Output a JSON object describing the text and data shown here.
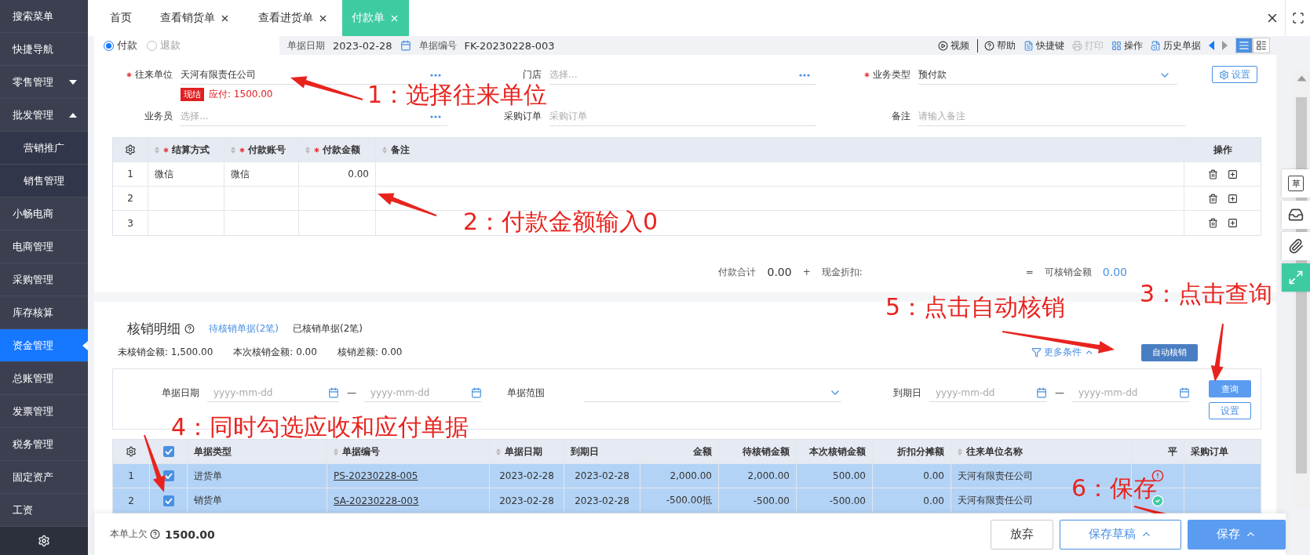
{
  "sidebar": {
    "items": [
      {
        "label": "搜索菜单",
        "kind": "item",
        "selected": false
      },
      {
        "label": "快捷导航",
        "kind": "item",
        "selected": false
      },
      {
        "label": "零售管理",
        "kind": "group",
        "expanded": false,
        "selected": false
      },
      {
        "label": "批发管理",
        "kind": "group",
        "expanded": true,
        "selected": false
      },
      {
        "label": "营销推广",
        "kind": "sub",
        "selected": false
      },
      {
        "label": "销售管理",
        "kind": "sub",
        "selected": false
      },
      {
        "label": "小畅电商",
        "kind": "item",
        "selected": false
      },
      {
        "label": "电商管理",
        "kind": "item",
        "selected": false
      },
      {
        "label": "采购管理",
        "kind": "item",
        "selected": false
      },
      {
        "label": "库存核算",
        "kind": "item",
        "selected": false
      },
      {
        "label": "资金管理",
        "kind": "item",
        "selected": true
      },
      {
        "label": "总账管理",
        "kind": "item",
        "selected": false
      },
      {
        "label": "发票管理",
        "kind": "item",
        "selected": false
      },
      {
        "label": "税务管理",
        "kind": "item",
        "selected": false
      },
      {
        "label": "固定资产",
        "kind": "item",
        "selected": false
      },
      {
        "label": "工资",
        "kind": "item",
        "selected": false
      }
    ]
  },
  "tabs": [
    {
      "label": "首页",
      "closable": false,
      "selected": false
    },
    {
      "label": "查看销货单",
      "closable": true,
      "selected": false
    },
    {
      "label": "查看进货单",
      "closable": true,
      "selected": false
    },
    {
      "label": "付款单",
      "closable": true,
      "selected": true
    }
  ],
  "toolbar": {
    "modes": [
      {
        "label": "付款",
        "selected": true
      },
      {
        "label": "退款",
        "selected": false
      }
    ],
    "date_label": "单据日期",
    "date": "2023-02-28",
    "number_label": "单据编号",
    "number": "FK-20230228-003",
    "actions": [
      {
        "kind": "video",
        "label": "视频",
        "disabled": false
      },
      {
        "kind": "help",
        "label": "帮助",
        "disabled": false
      },
      {
        "kind": "keys",
        "label": "快捷键",
        "disabled": false
      },
      {
        "kind": "print",
        "label": "打印",
        "disabled": true
      },
      {
        "kind": "ops",
        "label": "操作",
        "disabled": false
      },
      {
        "kind": "history",
        "label": "历史单据",
        "disabled": false
      }
    ],
    "views": [
      {
        "kind": "list",
        "selected": true
      },
      {
        "kind": "detail",
        "selected": false
      }
    ]
  },
  "form": {
    "fields": [
      {
        "label": "往来单位",
        "required": true,
        "kind": "picker",
        "value": "天河有限责任公司"
      },
      {
        "label": "门店",
        "required": false,
        "kind": "picker",
        "placeholder": "选择..."
      },
      {
        "label": "业务类型",
        "required": true,
        "kind": "select",
        "value": "预付款"
      },
      {
        "label": "业务员",
        "required": false,
        "kind": "picker",
        "placeholder": "选择..."
      },
      {
        "label": "采购订单",
        "required": false,
        "kind": "text",
        "placeholder": "采购订单"
      },
      {
        "label": "备注",
        "required": false,
        "kind": "text",
        "placeholder": "请输入备注"
      }
    ],
    "tag": "现结",
    "due": "应付: 1500.00",
    "settings_button": "设置"
  },
  "payments": {
    "columns": [
      {
        "label": "结算方式",
        "required": true
      },
      {
        "label": "付款账号",
        "required": true
      },
      {
        "label": "付款金额",
        "required": true
      },
      {
        "label": "备注",
        "required": false
      }
    ],
    "actions_label": "操作",
    "rows": [
      {
        "index": "1",
        "method": "微信",
        "account": "微信",
        "amount": "0.00"
      },
      {
        "index": "2"
      },
      {
        "index": "3"
      }
    ]
  },
  "totals": {
    "paid_label": "付款合计",
    "paid": "0.00",
    "plus": "+",
    "discount_label": "现金折扣:",
    "equals": "=",
    "available_label": "可核销金额",
    "available": "0.00"
  },
  "writeoff": {
    "title": "核销明细",
    "tabs": [
      {
        "label": "待核销单据(2笔)",
        "selected": true
      },
      {
        "label": "已核销单据(2笔)",
        "selected": false
      }
    ],
    "summary": [
      "未核销金额: 1,500.00",
      "本次核销金额: 0.00",
      "核销差额: 0.00"
    ],
    "more": "更多条件",
    "auto_button": "自动核销",
    "filters": {
      "date_label": "单据日期",
      "date_from": "yyyy-mm-dd",
      "date_to": "yyyy-mm-dd",
      "dash": "—",
      "range_label": "单据范围",
      "due_label": "到期日",
      "due_from": "yyyy-mm-dd",
      "due_to": "yyyy-mm-dd",
      "dash2": "—",
      "query_button": "查询",
      "settings_button": "设置"
    },
    "all_checked": true,
    "columns": [
      {
        "label": "单据类型",
        "sortable": false
      },
      {
        "label": "单据编号",
        "sortable": true
      },
      {
        "label": "单据日期",
        "sortable": true
      },
      {
        "label": "到期日",
        "sortable": false
      },
      {
        "label": "金额",
        "sortable": false
      },
      {
        "label": "待核销金额",
        "sortable": false
      },
      {
        "label": "本次核销金额",
        "sortable": false
      },
      {
        "label": "折扣分摊额",
        "sortable": false
      },
      {
        "label": "往来单位名称",
        "sortable": true
      },
      {
        "label": "平",
        "sortable": false
      },
      {
        "label": "采购订单",
        "sortable": false
      }
    ],
    "rows": [
      {
        "index": "1",
        "checked": true,
        "type": "进货单",
        "number": "PS-20230228-005",
        "date": "2023-02-28",
        "due": "2023-02-28",
        "amount": "2,000.00",
        "pending": "2,000.00",
        "current": "500.00",
        "discount": "0.00",
        "partner": "天河有限责任公司",
        "balanced": false
      },
      {
        "index": "2",
        "checked": true,
        "type": "销货单",
        "number": "SA-20230228-003",
        "date": "2023-02-28",
        "due": "2023-02-28",
        "amount": "-500.00抵",
        "pending": "-500.00",
        "current": "-500.00",
        "discount": "0.00",
        "partner": "天河有限责任公司",
        "balanced": true
      }
    ]
  },
  "footer": {
    "owed_label": "本单上欠",
    "owed": "1500.00",
    "buttons": [
      {
        "label": "放弃",
        "kind": "plain",
        "menu": false
      },
      {
        "label": "保存草稿",
        "kind": "outline",
        "menu": true
      },
      {
        "label": "保存",
        "kind": "primary",
        "menu": true
      }
    ]
  },
  "side_tools": [
    {
      "kind": "draft",
      "label": "草",
      "selected": false
    },
    {
      "kind": "inbox",
      "selected": false
    },
    {
      "kind": "clip",
      "selected": false
    },
    {
      "kind": "expand",
      "selected": true
    }
  ],
  "annotations": [
    {
      "text": "1：选择往来单位"
    },
    {
      "text": "2：付款金额输入0"
    },
    {
      "text": "5：点击自动核销"
    },
    {
      "text": "3：点击查询"
    },
    {
      "text": "4：同时勾选应收和应付单据"
    },
    {
      "text": "6：保存"
    }
  ]
}
